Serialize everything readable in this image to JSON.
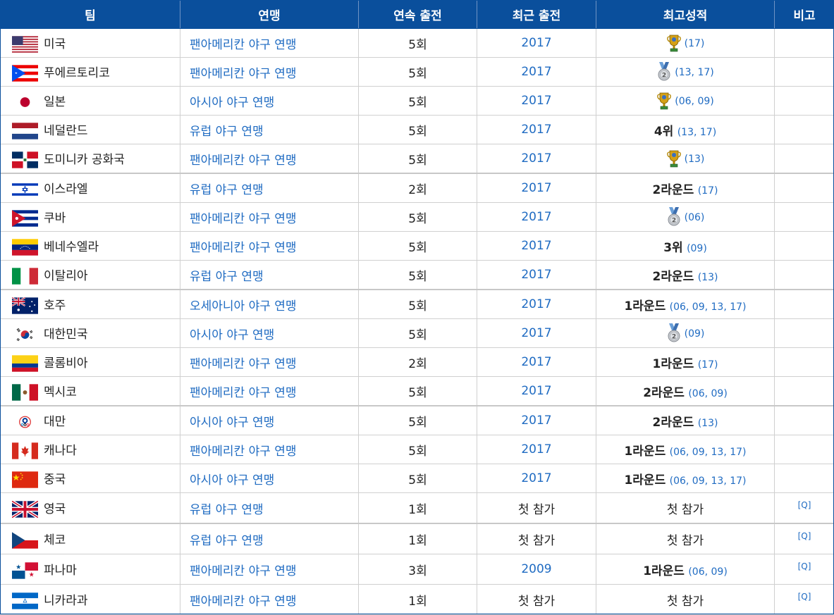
{
  "header": [
    "팀",
    "연맹",
    "연속 출전",
    "최근 출전",
    "최고성적",
    "비고"
  ],
  "rows": [
    {
      "team": "미국",
      "league": "팬아메리칸 야구 연맹",
      "streak": "5회",
      "recent": "2017",
      "best": "",
      "best_icon": "trophy",
      "best_years": "(17)",
      "note": ""
    },
    {
      "team": "푸에르토리코",
      "league": "팬아메리칸 야구 연맹",
      "streak": "5회",
      "recent": "2017",
      "best": "",
      "best_icon": "silver-medal",
      "best_years": "(13, 17)",
      "note": ""
    },
    {
      "team": "일본",
      "league": "아시아 야구 연맹",
      "streak": "5회",
      "recent": "2017",
      "best": "",
      "best_icon": "trophy",
      "best_years": "(06, 09)",
      "note": ""
    },
    {
      "team": "네덜란드",
      "league": "유럽 야구 연맹",
      "streak": "5회",
      "recent": "2017",
      "best": "4위",
      "best_icon": "",
      "best_years": "(13, 17)",
      "note": ""
    },
    {
      "team": "도미니카 공화국",
      "league": "팬아메리칸 야구 연맹",
      "streak": "5회",
      "recent": "2017",
      "best": "",
      "best_icon": "trophy",
      "best_years": "(13)",
      "note": ""
    },
    {
      "team": "이스라엘",
      "league": "유럽 야구 연맹",
      "streak": "2회",
      "recent": "2017",
      "best": "2라운드",
      "best_icon": "",
      "best_years": "(17)",
      "note": ""
    },
    {
      "team": "쿠바",
      "league": "팬아메리칸 야구 연맹",
      "streak": "5회",
      "recent": "2017",
      "best": "",
      "best_icon": "silver-medal",
      "best_years": "(06)",
      "note": ""
    },
    {
      "team": "베네수엘라",
      "league": "팬아메리칸 야구 연맹",
      "streak": "5회",
      "recent": "2017",
      "best": "3위",
      "best_icon": "",
      "best_years": "(09)",
      "note": ""
    },
    {
      "team": "이탈리아",
      "league": "유럽 야구 연맹",
      "streak": "5회",
      "recent": "2017",
      "best": "2라운드",
      "best_icon": "",
      "best_years": "(13)",
      "note": ""
    },
    {
      "team": "호주",
      "league": "오세아니아 야구 연맹",
      "streak": "5회",
      "recent": "2017",
      "best": "1라운드",
      "best_icon": "",
      "best_years": "(06, 09, 13, 17)",
      "note": ""
    },
    {
      "team": "대한민국",
      "league": "아시아 야구 연맹",
      "streak": "5회",
      "recent": "2017",
      "best": "",
      "best_icon": "silver-medal",
      "best_years": "(09)",
      "note": ""
    },
    {
      "team": "콜롬비아",
      "league": "팬아메리칸 야구 연맹",
      "streak": "2회",
      "recent": "2017",
      "best": "1라운드",
      "best_icon": "",
      "best_years": "(17)",
      "note": ""
    },
    {
      "team": "멕시코",
      "league": "팬아메리칸 야구 연맹",
      "streak": "5회",
      "recent": "2017",
      "best": "2라운드",
      "best_icon": "",
      "best_years": "(06, 09)",
      "note": ""
    },
    {
      "team": "대만",
      "league": "아시아 야구 연맹",
      "streak": "5회",
      "recent": "2017",
      "best": "2라운드",
      "best_icon": "",
      "best_years": "(13)",
      "note": ""
    },
    {
      "team": "캐나다",
      "league": "팬아메리칸 야구 연맹",
      "streak": "5회",
      "recent": "2017",
      "best": "1라운드",
      "best_icon": "",
      "best_years": "(06, 09, 13, 17)",
      "note": ""
    },
    {
      "team": "중국",
      "league": "아시아 야구 연맹",
      "streak": "5회",
      "recent": "2017",
      "best": "1라운드",
      "best_icon": "",
      "best_years": "(06, 09, 13, 17)",
      "note": ""
    },
    {
      "team": "영국",
      "league": "유럽 야구 연맹",
      "streak": "1회",
      "recent": "첫 참가",
      "best": "첫 참가",
      "best_icon": "",
      "best_years": "",
      "note": "[Q]"
    },
    {
      "team": "체코",
      "league": "유럽 야구 연맹",
      "streak": "1회",
      "recent": "첫 참가",
      "best": "첫 참가",
      "best_icon": "",
      "best_years": "",
      "note": "[Q]"
    },
    {
      "team": "파나마",
      "league": "팬아메리칸 야구 연맹",
      "streak": "3회",
      "recent": "2009",
      "best": "1라운드",
      "best_icon": "",
      "best_years": "(06, 09)",
      "note": "[Q]"
    },
    {
      "team": "니카라과",
      "league": "팬아메리칸 야구 연맹",
      "streak": "1회",
      "recent": "첫 참가",
      "best": "첫 참가",
      "best_icon": "",
      "best_years": "",
      "note": "[Q]"
    }
  ]
}
